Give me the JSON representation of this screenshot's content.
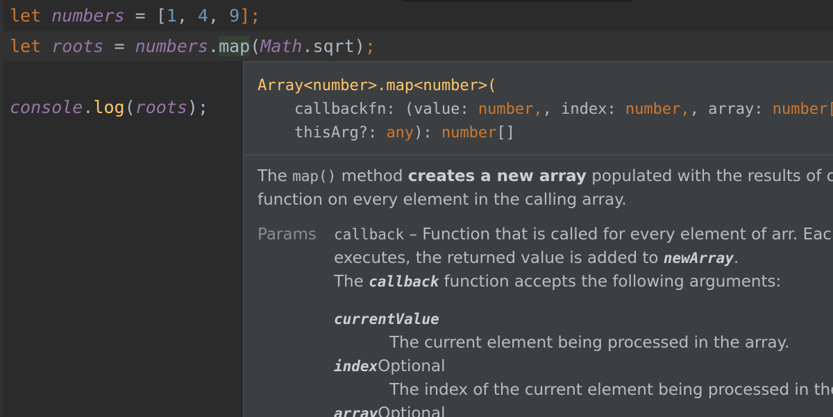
{
  "editor": {
    "line1": {
      "kw": "let",
      "var": "numbers",
      "eq": " = [",
      "n1": "1",
      "c1": ", ",
      "n2": "4",
      "c2": ", ",
      "n3": "9",
      "end": "];"
    },
    "line2": {
      "kw": "let",
      "var": "roots",
      "eq": " = ",
      "obj": "numbers",
      "dot": ".",
      "method": "map",
      "open": "(",
      "cls": "Math",
      "dot2": ".",
      "fn": "sqrt",
      "close": ")",
      "semi": ";"
    },
    "line4": {
      "obj": "console",
      "dot": ".",
      "fn": "log",
      "open": "(",
      "arg": "roots",
      "close": ");"
    }
  },
  "popup": {
    "signature": {
      "line1": "Array<number>.map<number>(",
      "l2_a": "    callbackfn: (value: ",
      "l2_t1": "number",
      "l2_b": ", index: ",
      "l2_t2": "number",
      "l2_c": ", array: ",
      "l2_t3": "number[]",
      "l3_a": "    thisArg?: ",
      "l3_t1": "any",
      "l3_b": "): ",
      "l3_t2": "number",
      "l3_c": "[]"
    },
    "description": {
      "a": "The ",
      "code": "map()",
      "b": " method ",
      "bold": "creates a new array",
      "c": " populated with the results of calling a provided",
      "line2": "function on every element in the calling array."
    },
    "params": {
      "label": "Params",
      "p1_code": "callback",
      "p1_text": " – Function that is called for every element of arr. Each time callback",
      "p2_text": "executes, the returned value is added to ",
      "p2_em": "newArray",
      "p2_end": ".",
      "p3_a": "The ",
      "p3_em": "callback",
      "p3_b": " function accepts the following arguments:",
      "arg1_name": "currentValue",
      "arg1_desc": "The current element being processed in the array.",
      "arg2_name": "index",
      "arg2_opt": "Optional",
      "arg2_desc": "The index of the current element being processed in the array.",
      "arg3_name": "array",
      "arg3_opt": "Optional"
    }
  }
}
